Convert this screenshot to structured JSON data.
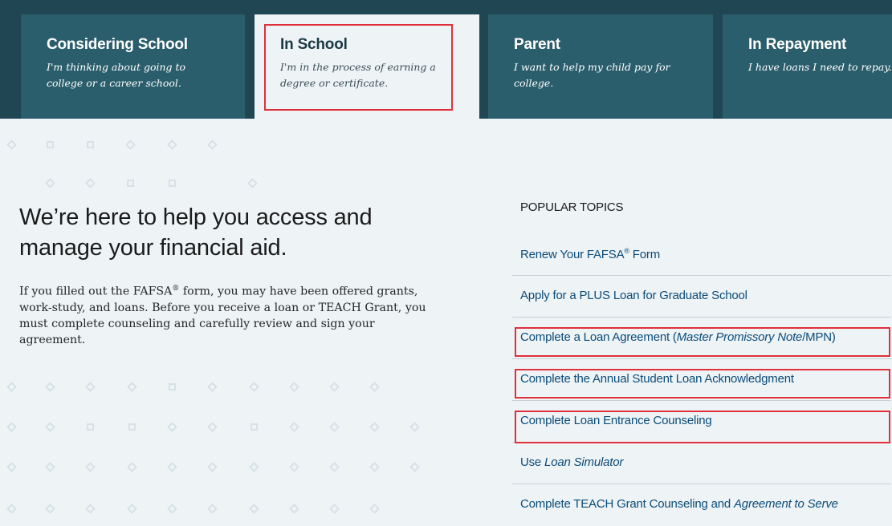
{
  "tabs": [
    {
      "title": "Considering School",
      "desc_line1": "I'm thinking about going to",
      "desc_line2": "college or a career school."
    },
    {
      "title": "In School",
      "desc_line1": "I'm in the process of earning a",
      "desc_line2": "degree or certificate."
    },
    {
      "title": "Parent",
      "desc_line1": "I want to help my child pay for",
      "desc_line2": "college."
    },
    {
      "title": "In Repayment",
      "desc_line1": "I have loans I need to repay.",
      "desc_line2": ""
    }
  ],
  "hero": {
    "heading_line1": "We’re here to help you access and",
    "heading_line2": "manage your financial aid.",
    "body_part1": "If you filled out the FAFSA",
    "body_reg": "®",
    "body_part2": " form, you may have been offered grants, work-study, and loans. Before you receive a loan or TEACH Grant, you must complete counseling and carefully review and sign your agreement."
  },
  "topics": {
    "title": "POPULAR TOPICS",
    "items": [
      {
        "a": "Renew Your FAFSA",
        "reg": "®",
        "b": " Form"
      },
      {
        "a": "Apply for a PLUS Loan for Graduate School"
      },
      {
        "a": "Complete a Loan Agreement (",
        "i": "Master Promissory Note",
        "b": "/MPN)"
      },
      {
        "a": "Complete the Annual Student Loan Acknowledgment"
      },
      {
        "a": "Complete Loan Entrance Counseling"
      },
      {
        "a": "Use ",
        "i": "Loan Simulator"
      },
      {
        "a": "Complete TEACH Grant Counseling and ",
        "i": "Agreement to Serve"
      }
    ]
  }
}
